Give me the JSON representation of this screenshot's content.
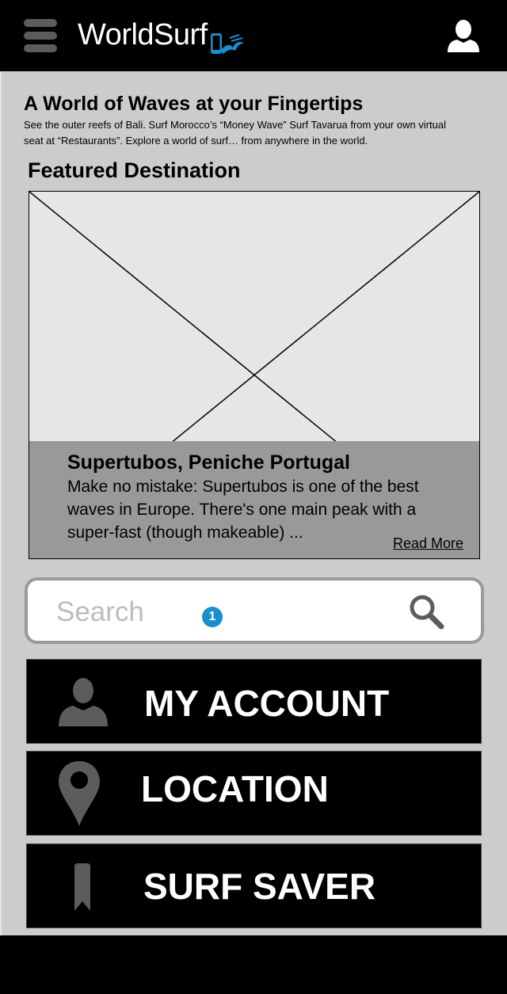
{
  "header": {
    "logo_text": "WorldSurf"
  },
  "intro": {
    "headline": "A World of Waves at your Fingertips",
    "body": "See the outer reefs of Bali. Surf Morocco’s “Money Wave” Surf Tavarua from your own virtual seat at “Restaurants”. Explore a world of surf… from anywhere in the world."
  },
  "featured": {
    "heading": "Featured Destination",
    "title": "Supertubos, Peniche Portugal",
    "body": "Make no mistake: Supertubos is one of the best waves in Europe. There's one main peak with a super-fast (though makeable) ...",
    "read_more": "Read More"
  },
  "search": {
    "placeholder": "Search",
    "badge": "1"
  },
  "nav": {
    "account": "MY ACCOUNT",
    "location": "LOCATION",
    "saver": "SURF SAVER"
  },
  "colors": {
    "accent": "#1a8fd0",
    "content_bg": "#cccccc",
    "caption_bg": "#999999",
    "icon_gray": "#5c5c5c"
  }
}
